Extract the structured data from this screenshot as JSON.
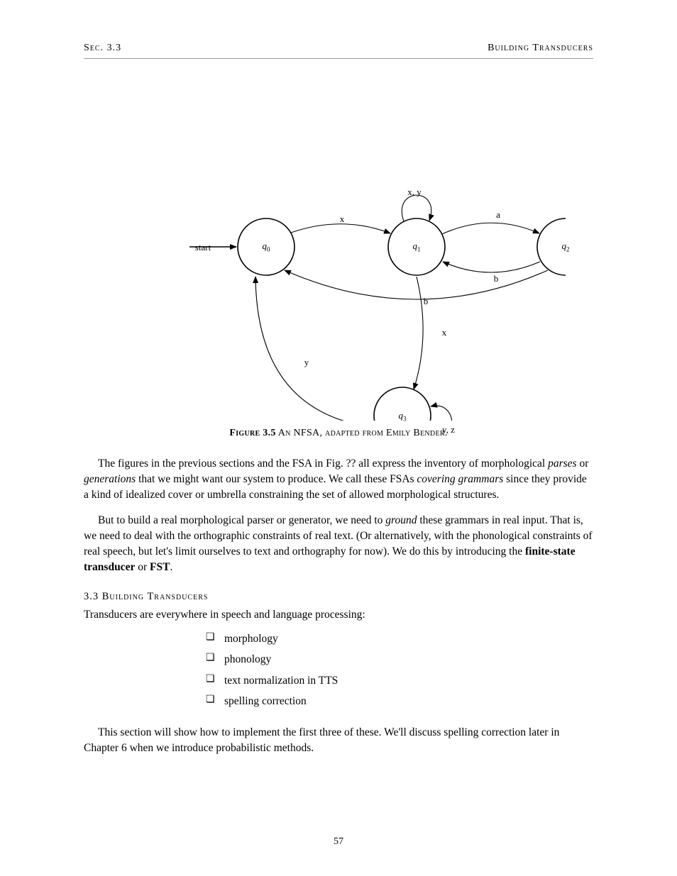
{
  "header": {
    "left": "Sec. 3.3",
    "right": "Building Transducers"
  },
  "figure": {
    "start_label": "start",
    "nodes": {
      "q0": {
        "name": "q",
        "sub": "0"
      },
      "q1": {
        "name": "q",
        "sub": "1"
      },
      "q2": {
        "name": "q",
        "sub": "2"
      },
      "q3": {
        "name": "q",
        "sub": "3"
      }
    },
    "edges": {
      "q0q1": "x",
      "q1self": "x, y",
      "q1q2a": "a",
      "q2q1b": "b",
      "q2q0b": "b",
      "q1q3": "x",
      "q3self": "y, z",
      "q3q0": "y"
    },
    "caption_strong": "Figure 3.5",
    "caption_rest": " An NFSA, adapted from Emily Bender."
  },
  "paragraphs": {
    "p1_a": "The figures in the previous sections and the FSA in Fig. ?? all express the inventory of morphological ",
    "p1_em": "parses",
    "p1_b": " or ",
    "p1_em2": "generations",
    "p1_c": " that we might want our system to produce. We call these FSAs ",
    "p1_em3": "covering grammars",
    "p1_d": " since they provide a kind of idealized cover or umbrella constraining the set of allowed morphological structures.",
    "p2_a": "But to build a real morphological parser or generator, we need to ",
    "p2_em": "ground",
    "p2_b": " these grammars in real input. That is, we need to deal with the orthographic constraints of real text. (Or alternatively, with the phonological constraints of real speech, but let's limit ourselves to text and orthography for now). We do this by introducing the ",
    "p2_strong": "finite-state transducer",
    "p2_c": " or ",
    "p2_strong2": "FST",
    "p2_d": "."
  },
  "subheading": "3.3 Building Transducers",
  "lead": "Transducers are everywhere in speech and language processing:",
  "bullets": [
    "morphology",
    "phonology",
    "text normalization in TTS",
    "spelling correction"
  ],
  "final_para": "This section will show how to implement the first three of these. We'll discuss spelling correction later in Chapter 6 when we introduce probabilistic methods.",
  "footer": "57"
}
